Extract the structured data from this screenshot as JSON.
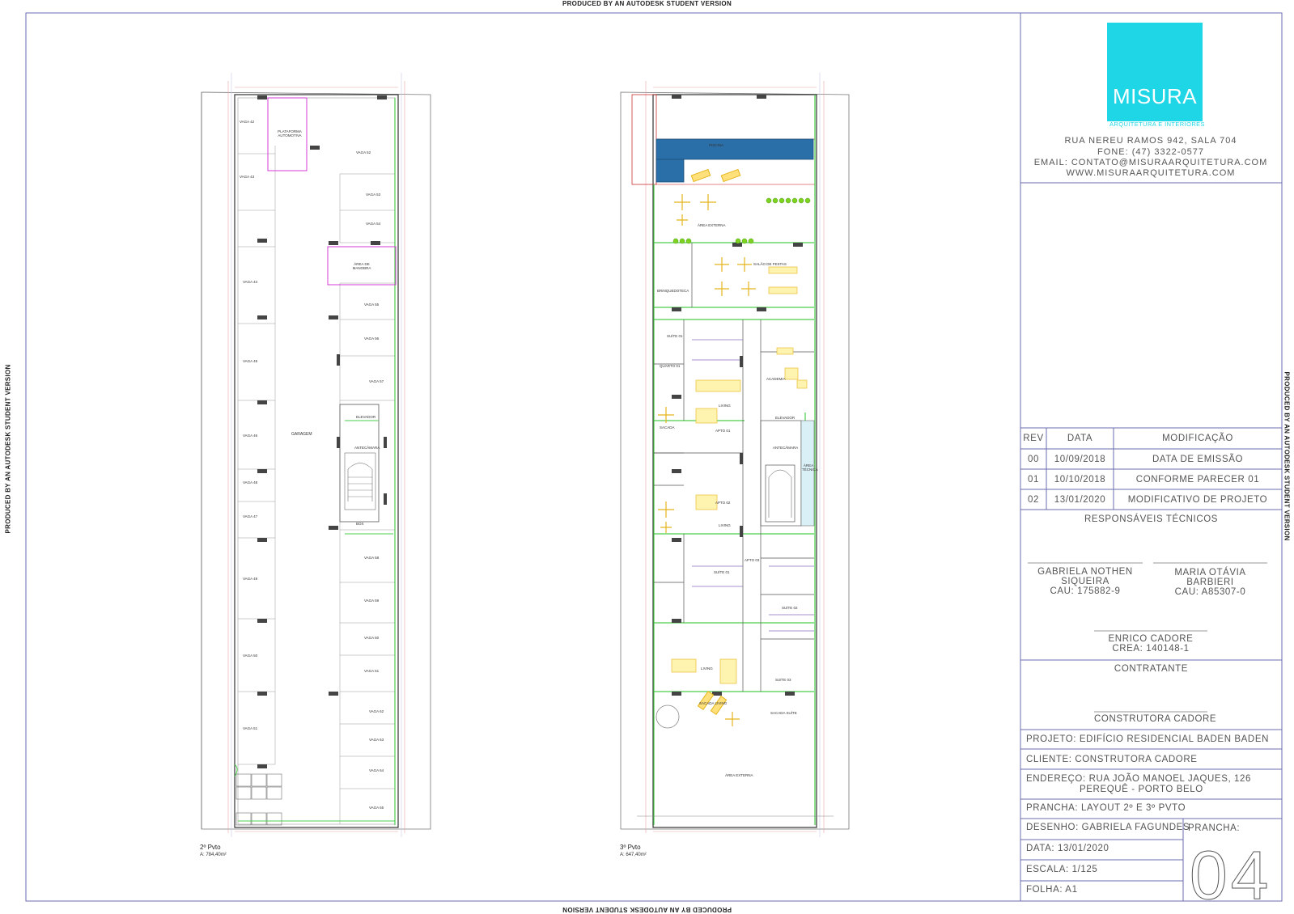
{
  "watermark": "PRODUCED BY AN AUTODESK STUDENT VERSION",
  "logo": {
    "name": "MISURA",
    "subtitle": "ARQUITETURA E INTERIORES",
    "brand_color": "#1ed6e6"
  },
  "office": {
    "address": "RUA NEREU RAMOS 942, SALA 704",
    "phone": "FONE: (47) 3322-0577",
    "email": "EMAIL: CONTATO@MISURAARQUITETURA.COM",
    "website": "WWW.MISURAARQUITETURA.COM"
  },
  "revisions": {
    "headers": [
      "REV",
      "DATA",
      "MODIFICAÇÃO"
    ],
    "rows": [
      [
        "00",
        "10/09/2018",
        "DATA DE EMISSÃO"
      ],
      [
        "01",
        "10/10/2018",
        "CONFORME PARECER 01"
      ],
      [
        "02",
        "13/01/2020",
        "MODIFICATIVO DE PROJETO"
      ]
    ]
  },
  "responsaveis": {
    "title": "RESPONSÁVEIS TÉCNICOS",
    "p1": {
      "name1": "GABRIELA NOTHEN",
      "name2": "SIQUEIRA",
      "cau": "CAU: 175882-9"
    },
    "p2": {
      "name1": "MARIA OTÁVIA",
      "name2": "BARBIERI",
      "cau": "CAU: A85307-0"
    },
    "p3": {
      "name": "ENRICO CADORE",
      "crea": "CREA: 140148-1"
    }
  },
  "contratante": {
    "title": "CONTRATANTE",
    "name": "CONSTRUTORA CADORE"
  },
  "project": {
    "projeto": "PROJETO: EDIFÍCIO RESIDENCIAL BADEN BADEN",
    "cliente": "CLIENTE: CONSTRUTORA CADORE",
    "endereco1": "ENDEREÇO: RUA JOÃO MANOEL JAQUES, 126",
    "endereco2": "PEREQUÊ - PORTO BELO",
    "prancha": "PRANCHA: LAYOUT 2º E 3º PVTO",
    "desenho": "DESENHO: GABRIELA FAGUNDES",
    "data": "DATA: 13/01/2020",
    "escala": "ESCALA: 1/125",
    "folha": "FOLHA: A1",
    "prancha_label": "PRANCHA:",
    "prancha_num": "04"
  },
  "plans": {
    "left": {
      "label": "2º Pvto",
      "area": "A: 784,40m²",
      "main_room": "GARAGEM"
    },
    "right": {
      "label": "3º Pvto",
      "area": "A: 647,40m²",
      "top_room": "PISCINA",
      "bottom_room": "ÁREA EXTERNA"
    }
  },
  "left_rooms": [
    "VAGA 42",
    "VAGA 43",
    "VAGA 44",
    "VAGA 45",
    "VAGA 46",
    "VAGA 48",
    "VAGA 47",
    "VAGA 49",
    "VAGA 50",
    "VAGA 51",
    "VAGA 52",
    "VAGA 53",
    "VAGA 54",
    "VAGA 55",
    "VAGA 56",
    "VAGA 57",
    "VAGA 58",
    "VAGA 59",
    "VAGA 60",
    "VAGA 61",
    "VAGA 62",
    "VAGA 63",
    "VAGA 64",
    "VAGA 65",
    "PLATAFORMA AUTOMOTIVA",
    "ÁREA DE MANOBRA",
    "ELEVADOR",
    "ANTECÂMARA",
    "BOX"
  ],
  "right_rooms": [
    "ÁREA EXTERNA",
    "SALÃO DE FESTAS",
    "BRINQUEDOTECA",
    "SUÍTE 01",
    "QUARTO 01",
    "LIVING",
    "APTO 01",
    "SACADA",
    "ACADEMIA",
    "ELEVADOR",
    "ANTECÂMARA",
    "ÁREA TÉCNICA",
    "APTO 02",
    "LIVING",
    "SUÍTE 01",
    "APTO 03",
    "SUÍTE 02",
    "SUÍTE 03",
    "LIVING",
    "SACADA LIVING",
    "SACADA SUÍTE"
  ]
}
